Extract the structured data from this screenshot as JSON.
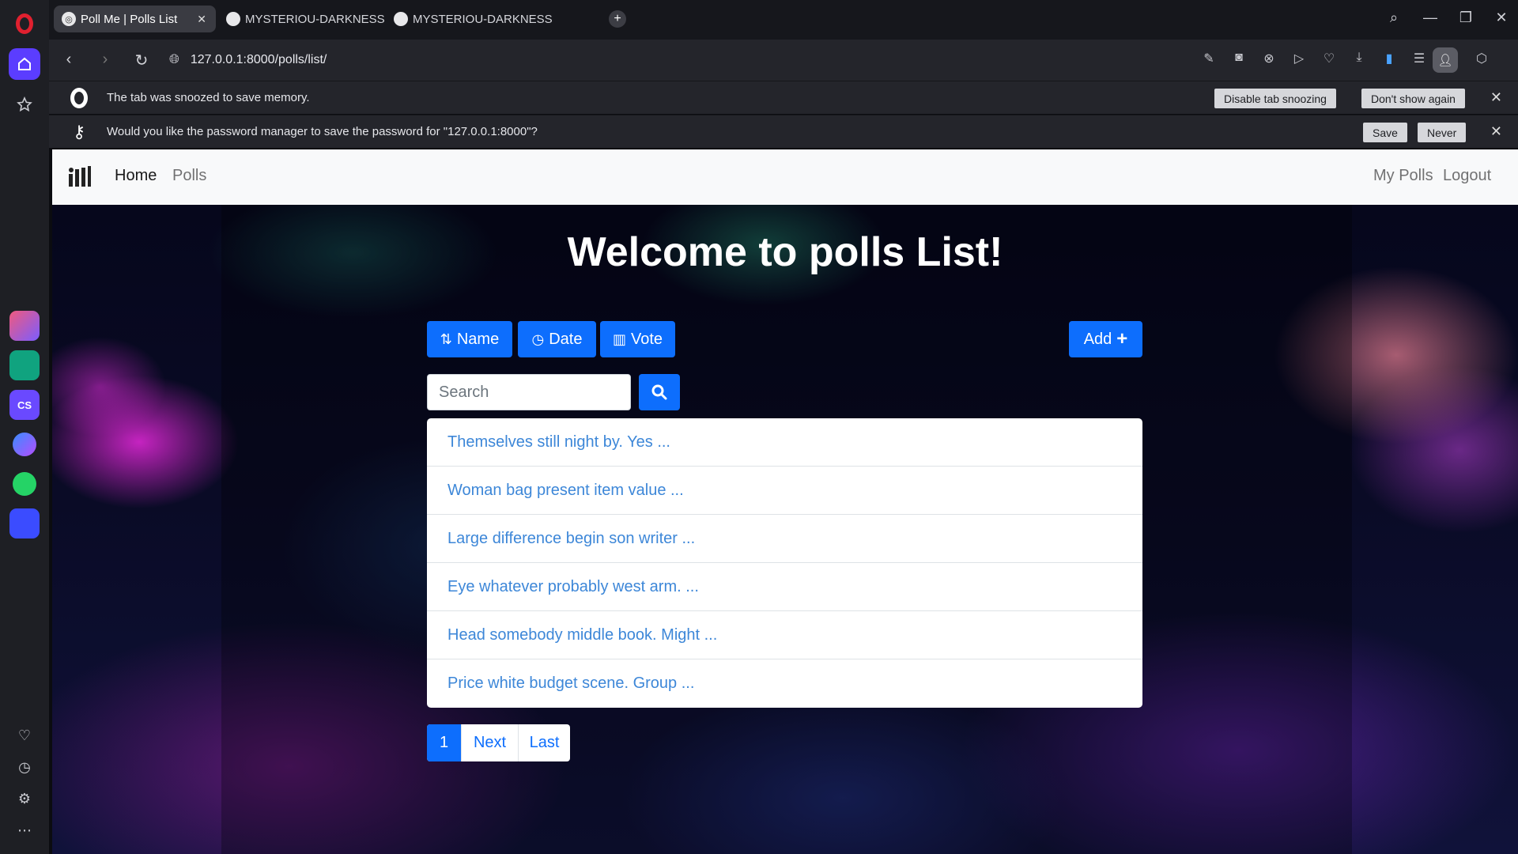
{
  "browser": {
    "tabs": [
      {
        "title": "Poll Me | Polls List",
        "active": true
      },
      {
        "title": "MYSTERIOU-DARKNESS/V",
        "active": false
      },
      {
        "title": "MYSTERIOU-DARKNESS/V",
        "active": false
      }
    ],
    "url": "127.0.0.1:8000/polls/list/"
  },
  "infobars": {
    "snooze": {
      "message": "The tab was snoozed to save memory.",
      "disable_label": "Disable tab snoozing",
      "dont_show_label": "Don't show again"
    },
    "password": {
      "message": "Would you like the password manager to save the password for \"127.0.0.1:8000\"?",
      "save_label": "Save",
      "never_label": "Never"
    }
  },
  "navbar": {
    "home_label": "Home",
    "polls_label": "Polls",
    "my_polls_label": "My Polls",
    "logout_label": "Logout"
  },
  "page": {
    "title": "Welcome to polls List!",
    "sort_buttons": {
      "name": "Name",
      "date": "Date",
      "vote": "Vote"
    },
    "add_label": "Add",
    "search_placeholder": "Search",
    "polls": [
      "Themselves still night by. Yes ...",
      "Woman bag present item value ...",
      "Large difference begin son writer ...",
      "Eye whatever probably west arm. ...",
      "Head somebody middle book. Might ...",
      "Price white budget scene. Group ..."
    ],
    "pagination": {
      "current": "1",
      "next": "Next",
      "last": "Last"
    }
  },
  "colors": {
    "primary": "#0d6efd",
    "link": "#3d87d8",
    "opera_red": "#e0202f",
    "opera_home": "#5b3dff"
  }
}
